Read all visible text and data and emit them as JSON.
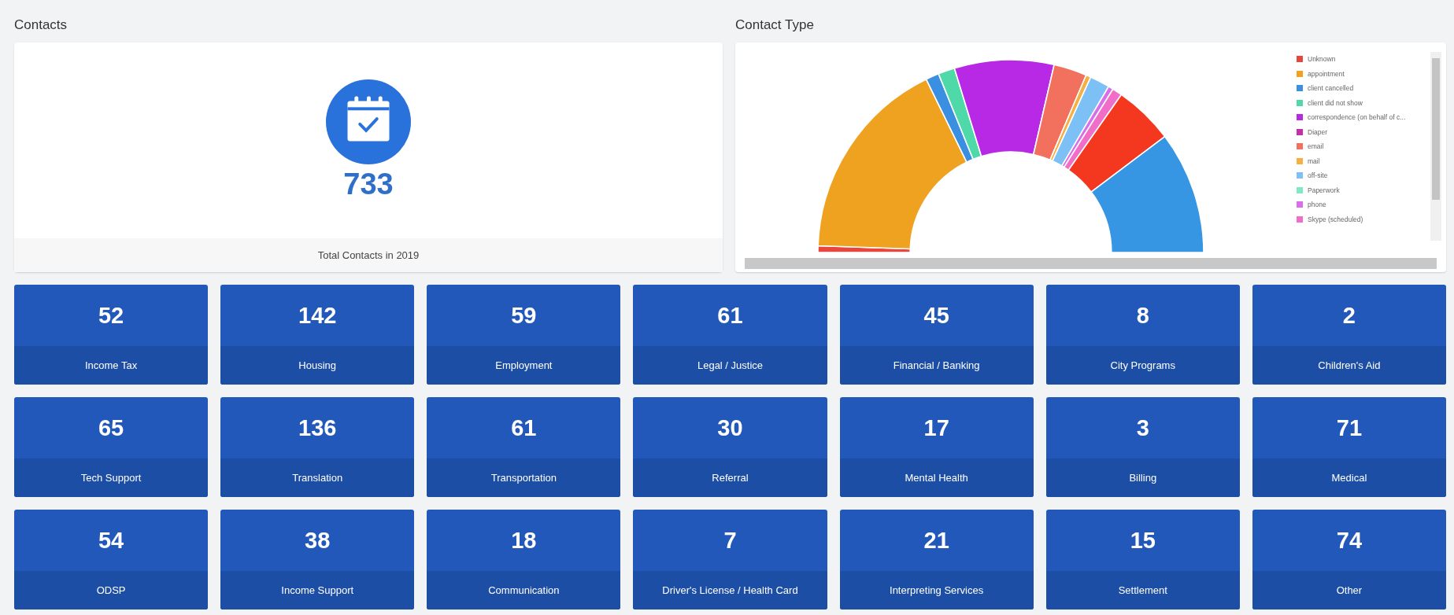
{
  "contacts": {
    "title": "Contacts",
    "count": "733",
    "caption": "Total Contacts in 2019"
  },
  "contact_type": {
    "title": "Contact Type",
    "legend": [
      {
        "label": "Unknown",
        "color": "#e8453c"
      },
      {
        "label": "appointment",
        "color": "#eea21f"
      },
      {
        "label": "client cancelled",
        "color": "#3b8fe0"
      },
      {
        "label": "client did not show",
        "color": "#4fd8a8"
      },
      {
        "label": "correspondence (on behalf of c...",
        "color": "#b829e6"
      },
      {
        "label": "Diaper",
        "color": "#c42fa8"
      },
      {
        "label": "email",
        "color": "#f2705e"
      },
      {
        "label": "mail",
        "color": "#f5b041"
      },
      {
        "label": "off-site",
        "color": "#7cc0f5"
      },
      {
        "label": "Paperwork",
        "color": "#7ee8c8"
      },
      {
        "label": "phone",
        "color": "#d86ee8"
      },
      {
        "label": "Skype (scheduled)",
        "color": "#f06ec8"
      }
    ]
  },
  "tiles": [
    {
      "value": "52",
      "label": "Income Tax"
    },
    {
      "value": "142",
      "label": "Housing"
    },
    {
      "value": "59",
      "label": "Employment"
    },
    {
      "value": "61",
      "label": "Legal / Justice"
    },
    {
      "value": "45",
      "label": "Financial / Banking"
    },
    {
      "value": "8",
      "label": "City Programs"
    },
    {
      "value": "2",
      "label": "Children's Aid"
    },
    {
      "value": "65",
      "label": "Tech Support"
    },
    {
      "value": "136",
      "label": "Translation"
    },
    {
      "value": "61",
      "label": "Transportation"
    },
    {
      "value": "30",
      "label": "Referral"
    },
    {
      "value": "17",
      "label": "Mental Health"
    },
    {
      "value": "3",
      "label": "Billing"
    },
    {
      "value": "71",
      "label": "Medical"
    },
    {
      "value": "54",
      "label": "ODSP"
    },
    {
      "value": "38",
      "label": "Income Support"
    },
    {
      "value": "18",
      "label": "Communication"
    },
    {
      "value": "7",
      "label": "Driver's License / Health Card"
    },
    {
      "value": "21",
      "label": "Interpreting Services"
    },
    {
      "value": "15",
      "label": "Settlement"
    },
    {
      "value": "74",
      "label": "Other"
    }
  ]
}
